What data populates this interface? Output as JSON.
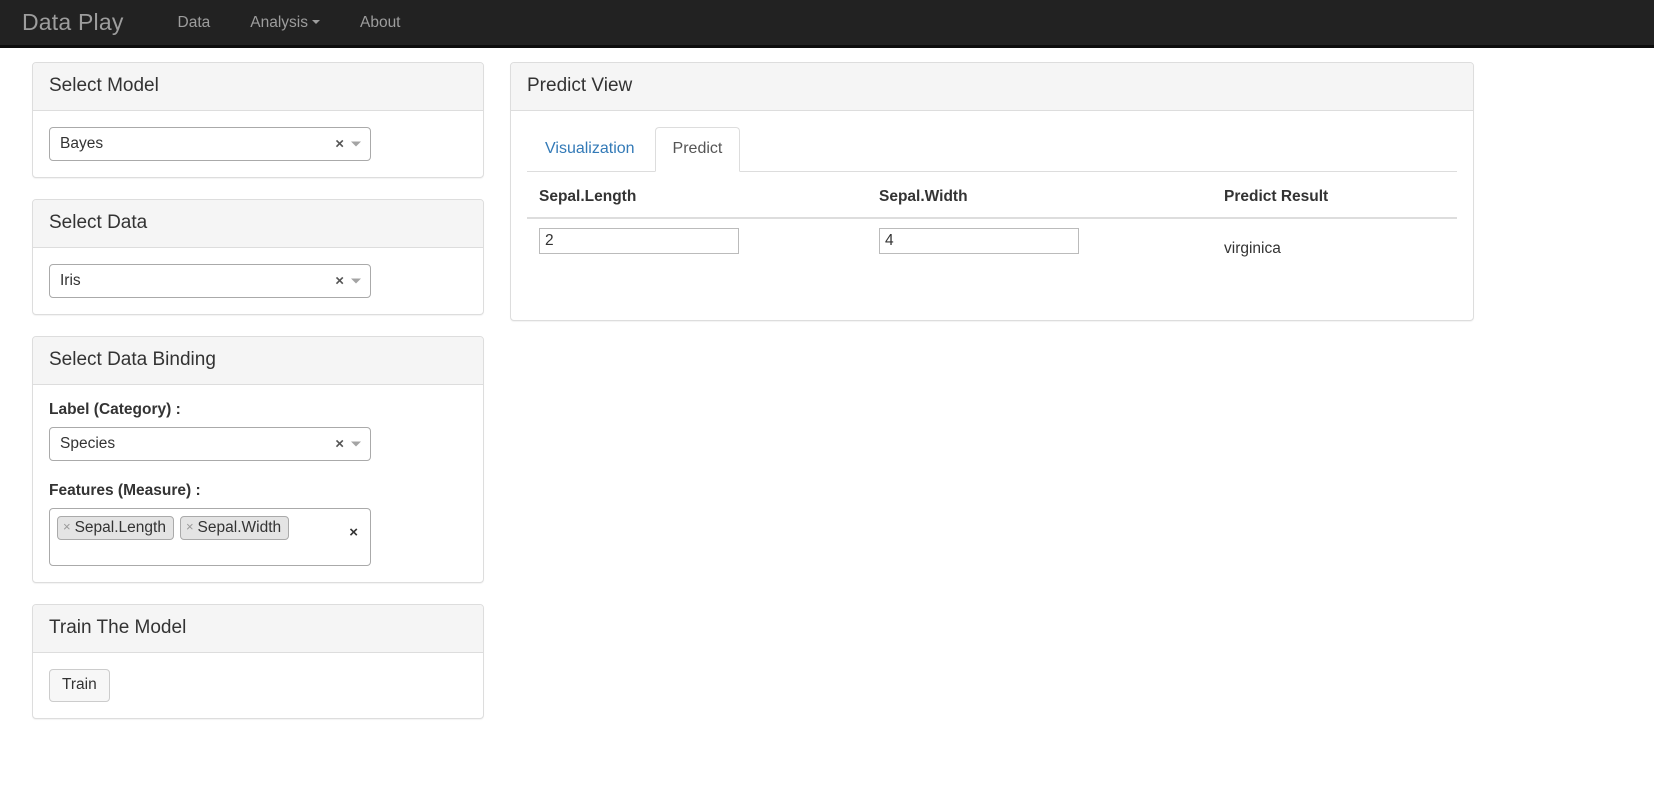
{
  "navbar": {
    "brand": "Data Play",
    "items": [
      {
        "label": "Data",
        "has_caret": false
      },
      {
        "label": "Analysis",
        "has_caret": true
      },
      {
        "label": "About",
        "has_caret": false
      }
    ]
  },
  "sidebar": {
    "select_model": {
      "title": "Select Model",
      "value": "Bayes",
      "clear_icon": "×",
      "arrow_icon": "▾"
    },
    "select_data": {
      "title": "Select Data",
      "value": "Iris",
      "clear_icon": "×",
      "arrow_icon": "▾"
    },
    "select_data_binding": {
      "title": "Select Data Binding",
      "label_field_label": "Label (Category) :",
      "label_field_value": "Species",
      "label_clear_icon": "×",
      "label_arrow_icon": "▾",
      "features_field_label": "Features (Measure) :",
      "features_values": [
        "Sepal.Length",
        "Sepal.Width"
      ],
      "tag_remove_icon": "×",
      "features_clear_icon": "×"
    },
    "train_the_model": {
      "title": "Train The Model",
      "train_button_label": "Train"
    }
  },
  "main": {
    "title": "Predict View",
    "tabs": [
      {
        "label": "Visualization",
        "active": false
      },
      {
        "label": "Predict",
        "active": true
      }
    ],
    "predict_table": {
      "headers": [
        "Sepal.Length",
        "Sepal.Width",
        "Predict Result"
      ],
      "row": {
        "sepal_length": "2",
        "sepal_width": "4",
        "predict_result": "virginica"
      }
    }
  },
  "colors": {
    "navbar_bg": "#222222",
    "navbar_text": "#9d9d9d",
    "panel_heading_bg": "#f5f5f5",
    "panel_border": "#dddddd",
    "link_blue": "#337ab7",
    "tag_bg": "#e4e4e4",
    "text": "#333333"
  }
}
